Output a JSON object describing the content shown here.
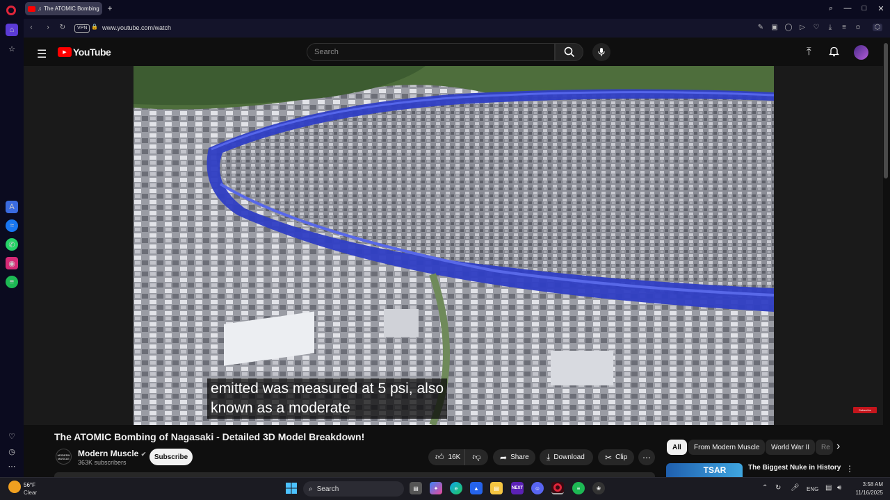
{
  "browser": {
    "tab_title": "The ATOMIC Bombing",
    "new_tab": "+",
    "url": "www.youtube.com/watch",
    "vpn_label": "VPN",
    "window_controls": [
      "search-icon",
      "minimize-icon",
      "maximize-icon",
      "close-icon"
    ]
  },
  "youtube": {
    "logo_text": "YouTube",
    "search_placeholder": "Search"
  },
  "video": {
    "caption_line1": "emitted was measured at 5 psi, also",
    "caption_line2": "known as a moderate",
    "watermark": "Subscribe"
  },
  "details": {
    "title": "The ATOMIC Bombing of Nagasaki - Detailed 3D Model Breakdown!",
    "channel_avatar_text": "MODERN MUSCLE",
    "channel_name": "Modern Muscle",
    "subscribers": "363K subscribers",
    "subscribe_label": "Subscribe",
    "likes": "16K",
    "share_label": "Share",
    "download_label": "Download",
    "clip_label": "Clip",
    "more_label": "⋯"
  },
  "chips": [
    "All",
    "From Modern Muscle",
    "World War II",
    "Re"
  ],
  "recommended": {
    "title": "The Biggest Nuke in History",
    "thumb_text": "TSAR"
  },
  "taskbar": {
    "weather_temp": "56°F",
    "weather_cond": "Clear",
    "search_label": "Search",
    "lang": "ENG",
    "time": "3:58 AM",
    "date": "11/16/2025"
  }
}
